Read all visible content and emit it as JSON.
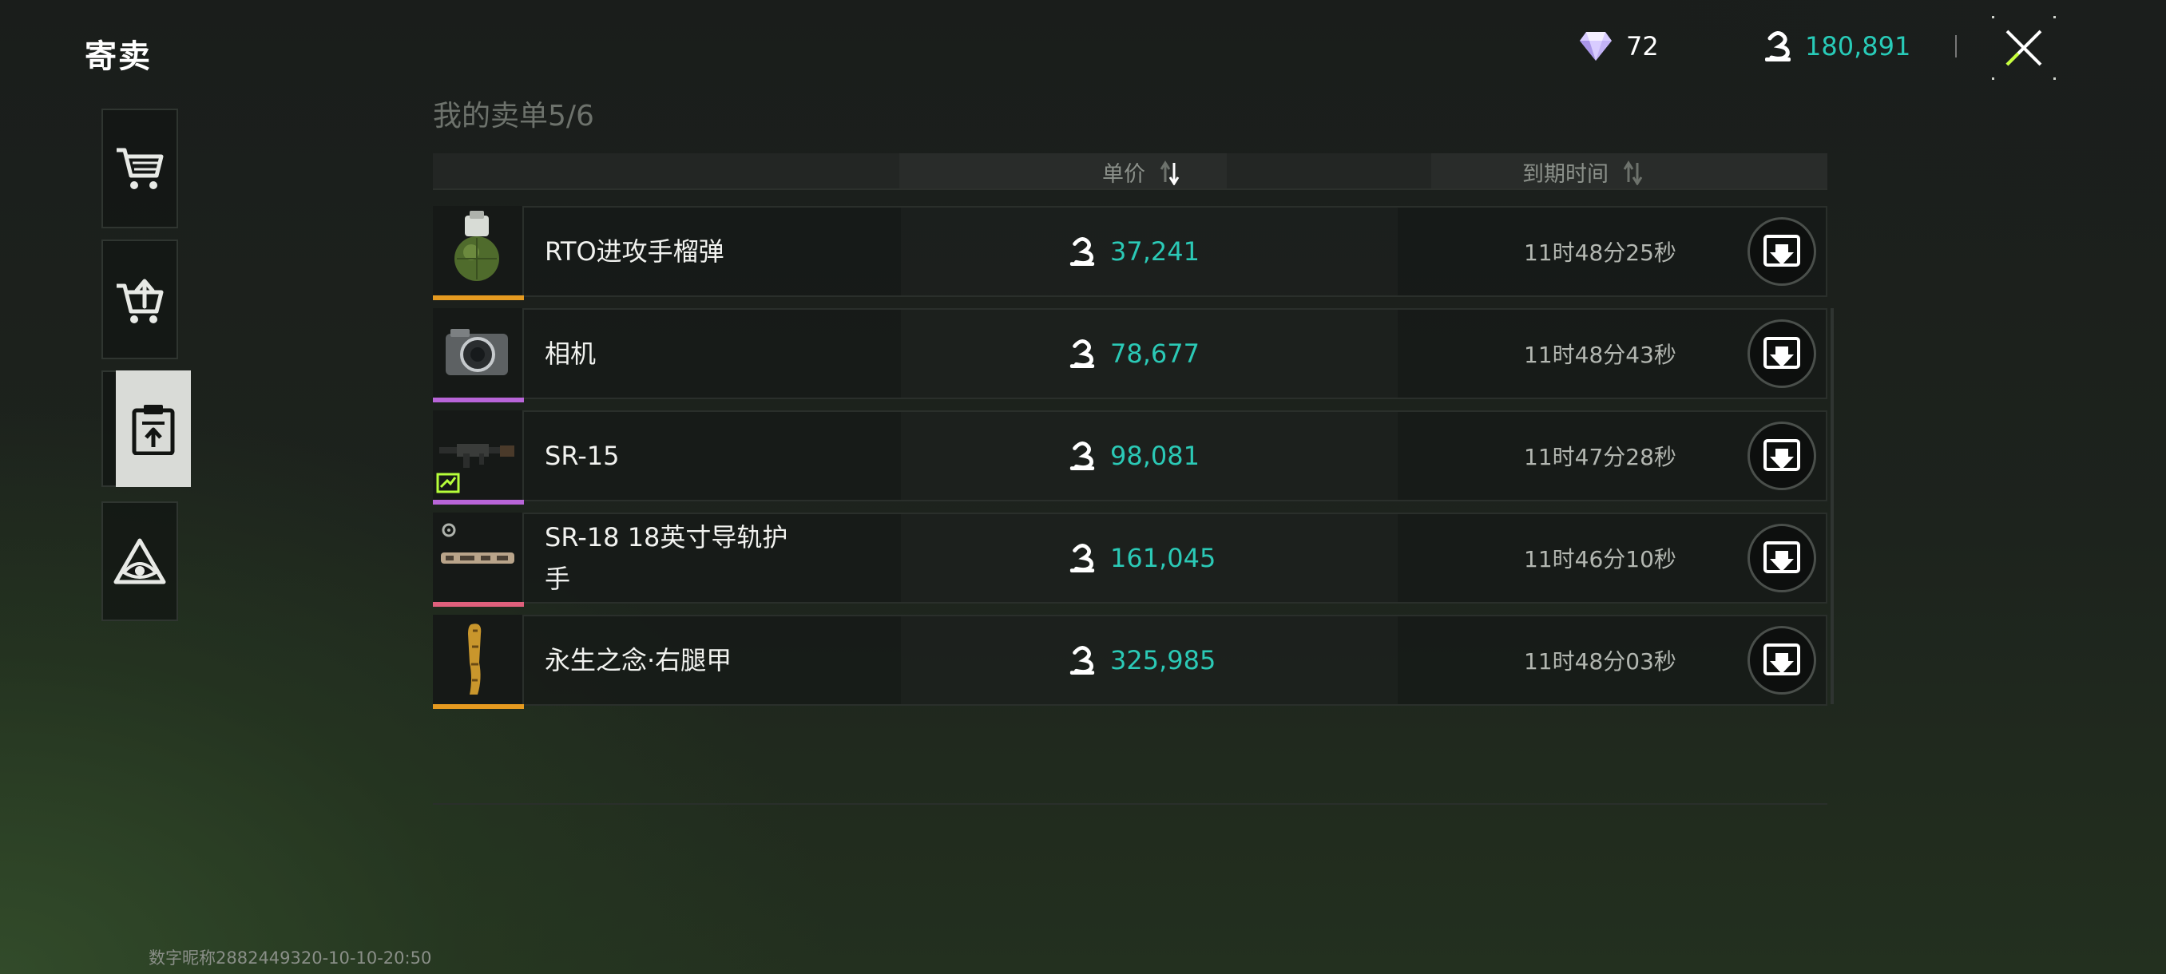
{
  "header": {
    "title": "寄卖",
    "diamonds": "72",
    "coins": "180,891"
  },
  "sidebar": {
    "items": [
      {
        "name": "buy",
        "icon": "cart-icon"
      },
      {
        "name": "sell",
        "icon": "cart-upload-icon"
      },
      {
        "name": "my-listings",
        "icon": "clipboard-upload-icon",
        "active": true
      },
      {
        "name": "other",
        "icon": "triangle-eye-icon"
      }
    ]
  },
  "listings": {
    "title": "我的卖单5/6",
    "col_price": "单价",
    "col_expire": "到期时间",
    "rows": [
      {
        "name": "RTO进攻手榴弹",
        "price": "37,241",
        "expire": "11时48分25秒",
        "rarity_color": "#e59a20",
        "icon": "grenade-icon"
      },
      {
        "name": "相机",
        "price": "78,677",
        "expire": "11时48分43秒",
        "rarity_color": "#b865d8",
        "icon": "camera-icon"
      },
      {
        "name": "SR-15",
        "price": "98,081",
        "expire": "11时47分28秒",
        "rarity_color": "#b865d8",
        "icon": "rifle-icon"
      },
      {
        "name": "SR-18 18英寸导轨护手",
        "price": "161,045",
        "expire": "11时46分10秒",
        "rarity_color": "#e0607c",
        "icon": "handguard-icon"
      },
      {
        "name": "永生之念·右腿甲",
        "price": "325,985",
        "expire": "11时48分03秒",
        "rarity_color": "#e59a20",
        "icon": "leg-armor-icon"
      }
    ]
  },
  "footer": {
    "watermark": "数字昵称2882449320-10-10-20:50"
  },
  "colors": {
    "accent_teal": "#2bc9b6",
    "background": "#1d211e"
  }
}
